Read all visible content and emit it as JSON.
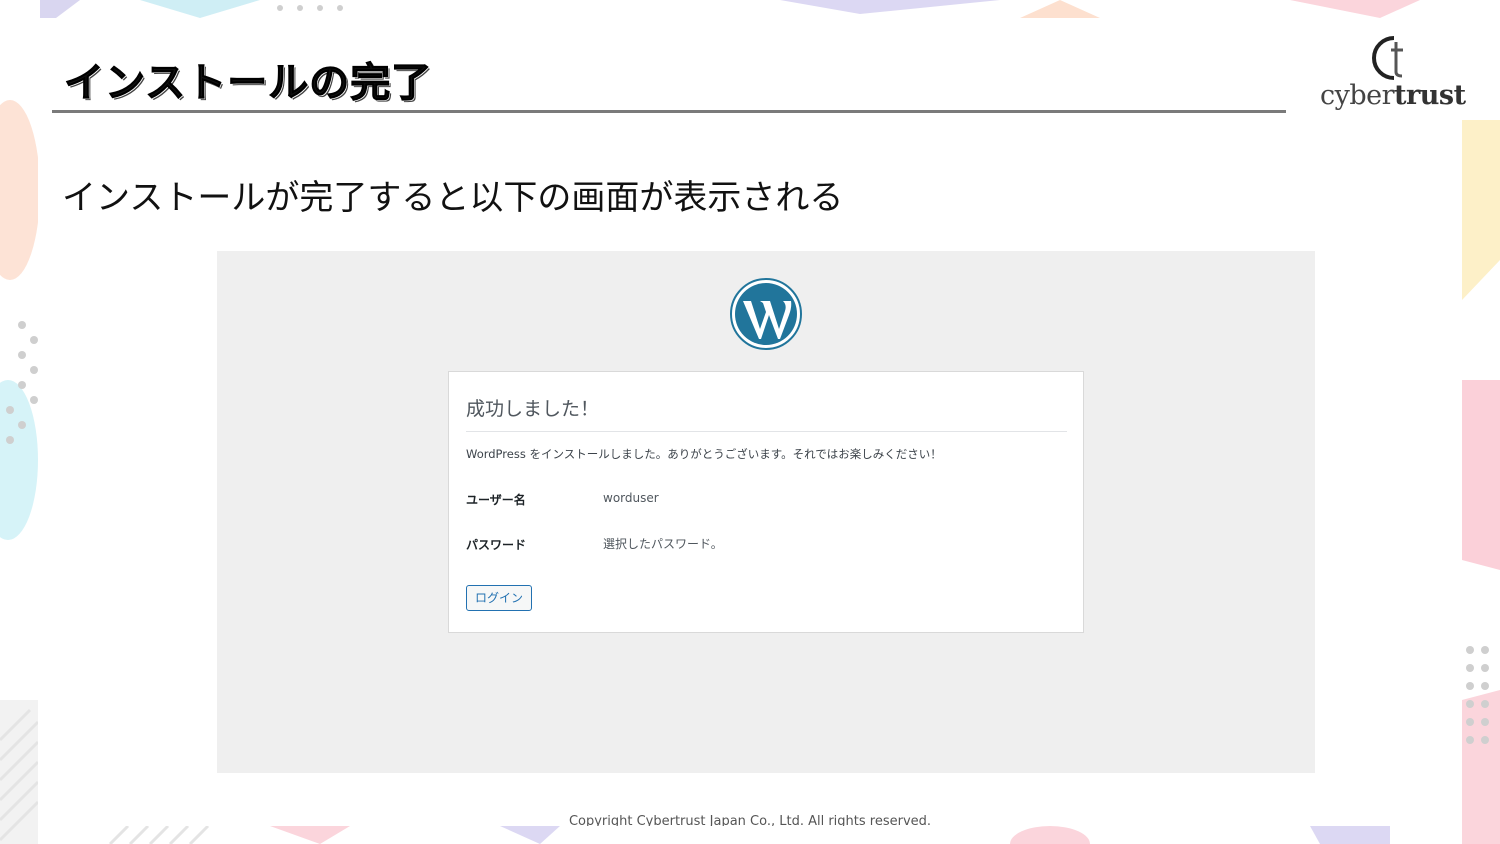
{
  "slide": {
    "title": "インストールの完了",
    "subtitle": "インストールが完了すると以下の画面が表示される",
    "logo_text_light": "cyber",
    "logo_text_bold": "trust",
    "footer": "Copyright Cybertrust Japan Co., Ltd. All rights reserved."
  },
  "wordpress": {
    "heading": "成功しました！",
    "message": "WordPress をインストールしました。ありがとうございます。それではお楽しみください！",
    "username_label": "ユーザー名",
    "username_value": "worduser",
    "password_label": "パスワード",
    "password_value": "選択したパスワード。",
    "login_button": "ログイン"
  },
  "colors": {
    "wp_blue": "#21759b",
    "button_blue": "#2271b1",
    "screenshot_bg": "#efefef"
  },
  "icons": {
    "wordpress_logo": "wordpress-logo-icon",
    "brand_logo": "cybertrust-logo-icon"
  }
}
